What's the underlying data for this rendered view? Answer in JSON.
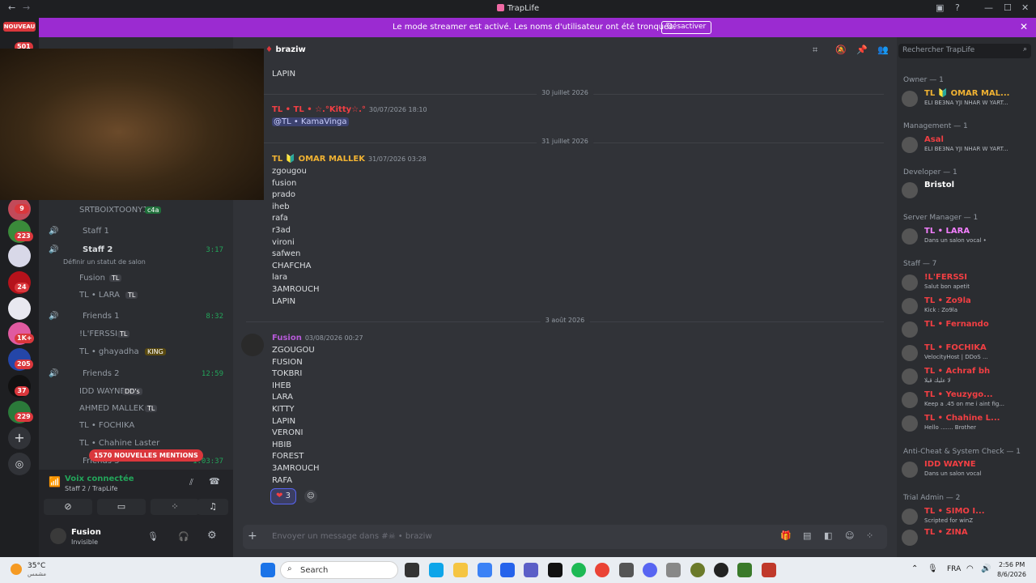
{
  "titlebar": {
    "title": "TrapLife"
  },
  "banner": {
    "message": "Le mode streamer est activé. Les noms d'utilisateur ont été tronqués.",
    "button": "Désactiver"
  },
  "rail": {
    "new_label": "NOUVEAU",
    "badges": [
      "501",
      "9",
      "223",
      "24",
      "1K+",
      "205",
      "37",
      "229"
    ]
  },
  "channels": {
    "top_user": "SRTBOIXTOONY11",
    "top_user_tag": "c4a",
    "staff1": "Staff 1",
    "staff2": "Staff 2",
    "staff2_time": "3:17",
    "staff2_status": "Définir un statut de salon",
    "staff2_members": [
      "Fusion",
      "TL • LARA"
    ],
    "friends1": "Friends 1",
    "friends1_time": "8:32",
    "friends1_members": [
      "!L'FERSSI",
      "TL • ghayadha"
    ],
    "friends2": "Friends 2",
    "friends2_time": "12:59",
    "friends2_members": [
      "IDD WAYNE",
      "AHMED MALLEK",
      "TL • FOCHIKA",
      "TL • Chahine Laster"
    ],
    "friends3": "Friends 3",
    "friends3_time": "1:03:37",
    "mentions": "1570 NOUVELLES MENTIONS",
    "tags": {
      "tl": "TL",
      "king": "KING",
      "dds": "DD's"
    }
  },
  "voice": {
    "status": "Voix connectée",
    "location": "Staff 2 / TrapLife"
  },
  "user": {
    "name": "Fusion",
    "status": "Invisible"
  },
  "chat": {
    "channel": "braziw",
    "search_placeholder": "Rechercher TrapLife",
    "top_lines": [
      "LAPIN"
    ],
    "date1": "30 juillet 2026",
    "msg1_author": "TL • TL • ☆.°Kitty☆.°",
    "msg1_time": "30/07/2026 18:10",
    "msg1_text": "@TL • KamaVinga",
    "date2": "31 juillet 2026",
    "msg2_author": "TL 🔰 OMAR MALLEK",
    "msg2_time": "31/07/2026 03:28",
    "msg2_lines": [
      "zgougou",
      "fusion",
      "prado",
      "iheb",
      "rafa",
      "r3ad",
      "vironi",
      "safwen",
      "CHAFCHA",
      "lara",
      "3AMROUCH",
      "LAPIN"
    ],
    "date3": "3 août 2026",
    "msg3_author": "Fusion",
    "msg3_time": "03/08/2026 00:27",
    "msg3_lines": [
      "ZGOUGOU",
      "FUSION",
      "TOKBRI",
      "IHEB",
      "LARA",
      "KITTY",
      "LAPIN",
      "VERONI",
      "HBIB",
      "FOREST",
      "3AMROUCH",
      "RAFA"
    ],
    "reaction_count": "3",
    "composer_placeholder": "Envoyer un message dans #☠ • braziw"
  },
  "members": {
    "groups": [
      "Owner — 1",
      "Management — 1",
      "Developer — 1",
      "Server Manager — 1",
      "Staff — 7",
      "Anti-Cheat & System Check — 1",
      "Trial Admin — 2"
    ],
    "list": [
      {
        "name": "TL 🔰 OMAR MAL...",
        "status": "ELI BE3NA YJI NHAR W YART...",
        "color": "#f0b232"
      },
      {
        "name": "Asal",
        "status": "ELI BE3NA YJI NHAR W YART...",
        "color": "#f23f43"
      },
      {
        "name": "Bristol",
        "status": "",
        "color": "#ffffff"
      },
      {
        "name": "TL • LARA",
        "status": "Dans un salon vocal •",
        "color": "#f47fff"
      },
      {
        "name": "!L'FERSSI",
        "status": "Salut bon apetit",
        "color": "#f23f43"
      },
      {
        "name": "TL • Zo9la",
        "status": "Kick : Zo9la",
        "color": "#f23f43"
      },
      {
        "name": "TL • Fernando",
        "status": "",
        "color": "#f23f43"
      },
      {
        "name": "TL • FOCHIKA",
        "status": "VelocityHost | DDoS ...",
        "color": "#f23f43"
      },
      {
        "name": "TL • Achraf bh",
        "status": "لا عليك قبلا",
        "color": "#f23f43"
      },
      {
        "name": "TL • Yeuzygo...",
        "status": "Keep a .45 on me i aint fig...",
        "color": "#f23f43"
      },
      {
        "name": "TL • Chahine L...",
        "status": "Hello ....... Brother",
        "color": "#f23f43"
      },
      {
        "name": "IDD WAYNE",
        "status": "Dans un salon vocal",
        "color": "#f23f43"
      },
      {
        "name": "TL • SIMO I...",
        "status": "Scripted for winZ",
        "color": "#f23f43"
      },
      {
        "name": "TL • ZINA",
        "status": "",
        "color": "#f23f43"
      }
    ]
  },
  "taskbar": {
    "weather": "35°C",
    "weather_sub": "مشمس",
    "search": "Search",
    "lang": "FRA",
    "time": "2:56 PM",
    "date": "8/6/2026"
  }
}
